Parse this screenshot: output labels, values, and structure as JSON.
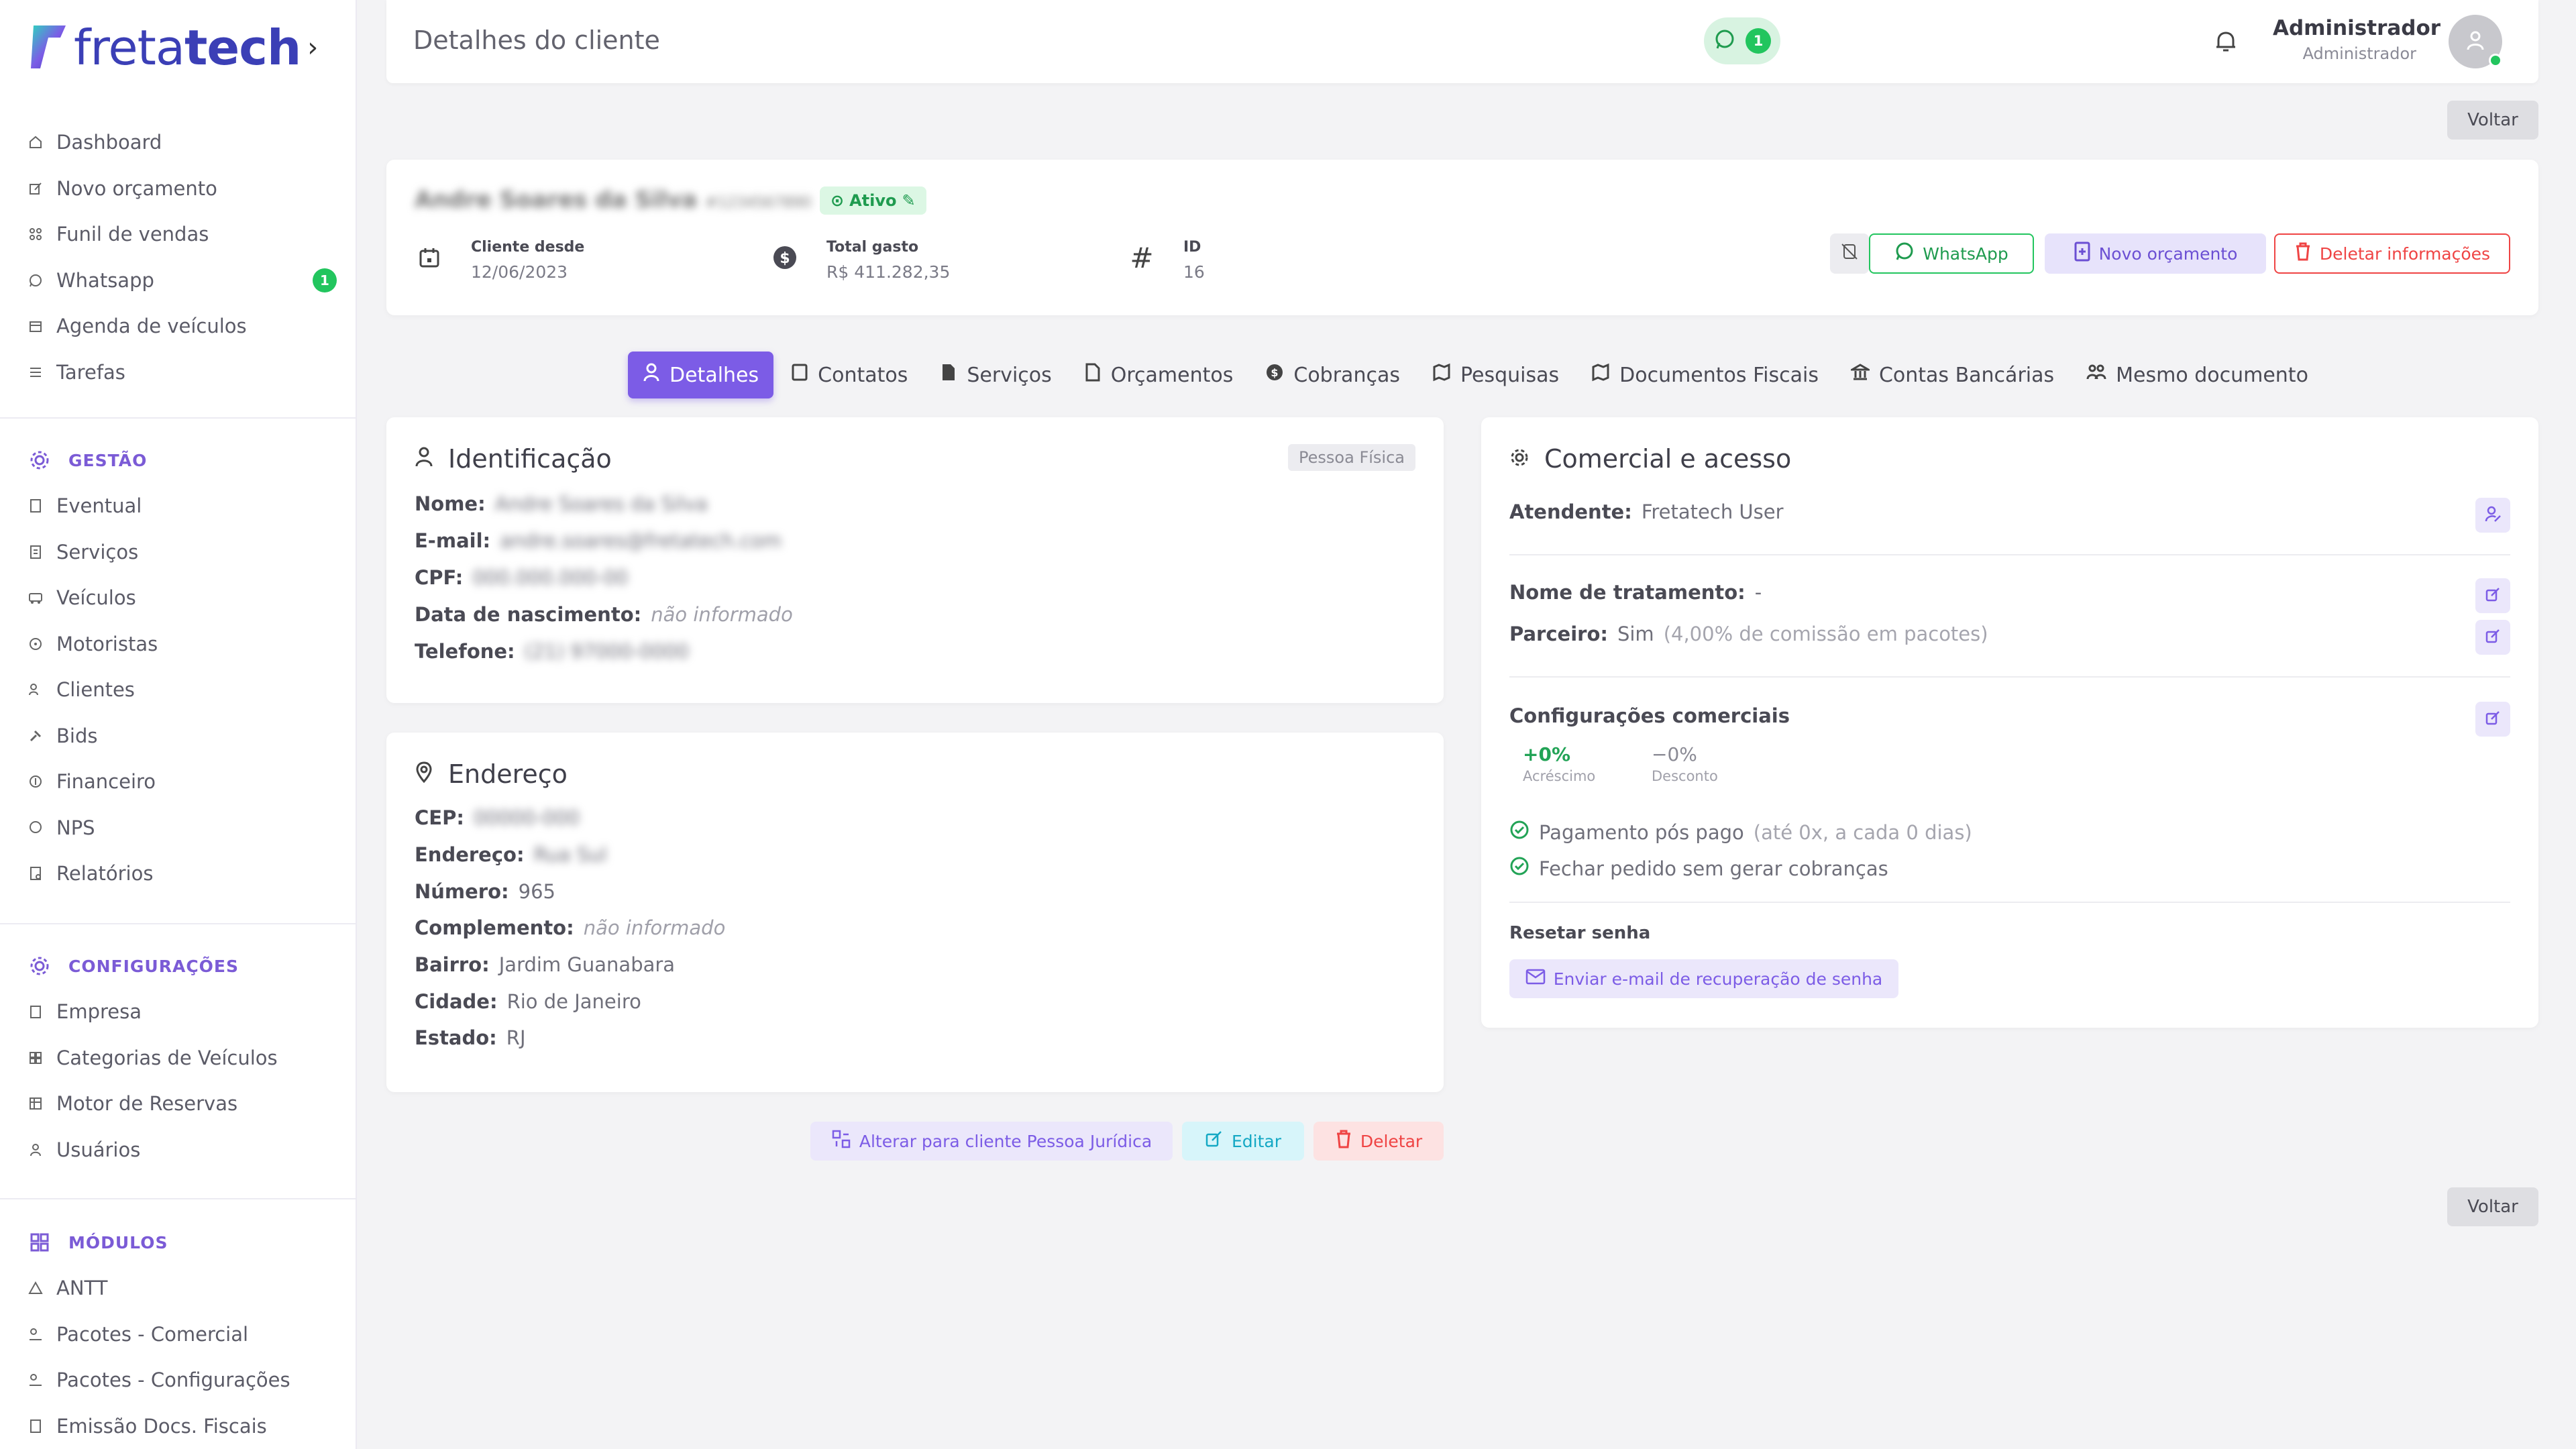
{
  "brand": {
    "name_light": "freta",
    "name_bold": "tech",
    "accent": "#3b3fb6"
  },
  "sidebar": {
    "main": [
      {
        "label": "Dashboard",
        "icon": "home-icon"
      },
      {
        "label": "Novo orçamento",
        "icon": "edit-icon"
      },
      {
        "label": "Funil de vendas",
        "icon": "funnel-icon"
      },
      {
        "label": "Whatsapp",
        "icon": "whatsapp-icon",
        "badge": "1"
      },
      {
        "label": "Agenda de veículos",
        "icon": "calendar-icon"
      },
      {
        "label": "Tarefas",
        "icon": "list-icon"
      }
    ],
    "gestao_title": "GESTÃO",
    "gestao": [
      {
        "label": "Eventual",
        "icon": "document-icon"
      },
      {
        "label": "Serviços",
        "icon": "receipt-icon"
      },
      {
        "label": "Veículos",
        "icon": "bus-icon"
      },
      {
        "label": "Motoristas",
        "icon": "steering-wheel-icon"
      },
      {
        "label": "Clientes",
        "icon": "users-icon"
      },
      {
        "label": "Bids",
        "icon": "gavel-icon"
      },
      {
        "label": "Financeiro",
        "icon": "coin-icon"
      },
      {
        "label": "NPS",
        "icon": "chat-icon"
      },
      {
        "label": "Relatórios",
        "icon": "report-icon"
      }
    ],
    "config_title": "CONFIGURAÇÕES",
    "config": [
      {
        "label": "Empresa",
        "icon": "building-icon"
      },
      {
        "label": "Categorias de Veículos",
        "icon": "grid-icon"
      },
      {
        "label": "Motor de Reservas",
        "icon": "table-icon"
      },
      {
        "label": "Usuários",
        "icon": "user-icon"
      }
    ],
    "modulos_title": "MÓDULOS",
    "modulos": [
      {
        "label": "ANTT",
        "icon": "triangle-icon"
      },
      {
        "label": "Pacotes - Comercial",
        "icon": "package-icon"
      },
      {
        "label": "Pacotes - Configurações",
        "icon": "package-settings-icon"
      },
      {
        "label": "Emissão Docs. Fiscais",
        "icon": "invoice-icon"
      }
    ]
  },
  "header": {
    "title": "Detalhes do cliente",
    "whatsapp_count": "1",
    "user_name": "Administrador",
    "user_role": "Administrador"
  },
  "back_label": "Voltar",
  "client": {
    "name": "Andre Soares da Silva",
    "sub": "#1234567890",
    "status": "Ativo",
    "since_label": "Cliente desde",
    "since_value": "12/06/2023",
    "spent_label": "Total gasto",
    "spent_value": "R$ 411.282,35",
    "id_label": "ID",
    "id_value": "16",
    "whatsapp_btn": "WhatsApp",
    "quote_btn": "Novo orçamento",
    "delete_btn": "Deletar informações"
  },
  "tabs": [
    {
      "label": "Detalhes",
      "icon": "user-icon",
      "active": true
    },
    {
      "label": "Contatos",
      "icon": "contacts-icon"
    },
    {
      "label": "Serviços",
      "icon": "document-icon"
    },
    {
      "label": "Orçamentos",
      "icon": "quote-icon"
    },
    {
      "label": "Cobranças",
      "icon": "coin-icon"
    },
    {
      "label": "Pesquisas",
      "icon": "map-icon"
    },
    {
      "label": "Documentos Fiscais",
      "icon": "map-icon"
    },
    {
      "label": "Contas Bancárias",
      "icon": "bank-icon"
    },
    {
      "label": "Mesmo documento",
      "icon": "group-icon"
    }
  ],
  "identificacao": {
    "title": "Identificação",
    "badge": "Pessoa Física",
    "nome_k": "Nome:",
    "nome_v": "Andre Soares da Silva",
    "email_k": "E-mail:",
    "email_v": "andre.soares@fretatech.com",
    "cpf_k": "CPF:",
    "cpf_v": "000.000.000-00",
    "nasc_k": "Data de nascimento:",
    "nasc_v": "não informado",
    "tel_k": "Telefone:",
    "tel_v": "(21) 97000-0000"
  },
  "endereco": {
    "title": "Endereço",
    "cep_k": "CEP:",
    "cep_v": "00000-000",
    "end_k": "Endereço:",
    "end_v": "Rua Sul",
    "num_k": "Número:",
    "num_v": "965",
    "comp_k": "Complemento:",
    "comp_v": "não informado",
    "bairro_k": "Bairro:",
    "bairro_v": "Jardim Guanabara",
    "cidade_k": "Cidade:",
    "cidade_v": "Rio de Janeiro",
    "estado_k": "Estado:",
    "estado_v": "RJ"
  },
  "comercial": {
    "title": "Comercial e acesso",
    "atendente_k": "Atendente:",
    "atendente_v": "Fretatech User",
    "trat_k": "Nome de tratamento:",
    "trat_v": "-",
    "parc_k": "Parceiro:",
    "parc_v": "Sim",
    "parc_note": "(4,00% de comissão em pacotes)",
    "config_title": "Configurações comerciais",
    "acrescimo_v": "+0%",
    "acrescimo_l": "Acréscimo",
    "desconto_v": "−0%",
    "desconto_l": "Desconto",
    "pag_v": "Pagamento pós pago",
    "pag_note": "(até 0x, a cada 0 dias)",
    "fechar_v": "Fechar pedido sem gerar cobranças",
    "reset_title": "Resetar senha",
    "reset_btn": "Enviar e-mail de recuperação de senha"
  },
  "actions": {
    "alterar": "Alterar para cliente Pessoa Jurídica",
    "editar": "Editar",
    "deletar": "Deletar"
  }
}
